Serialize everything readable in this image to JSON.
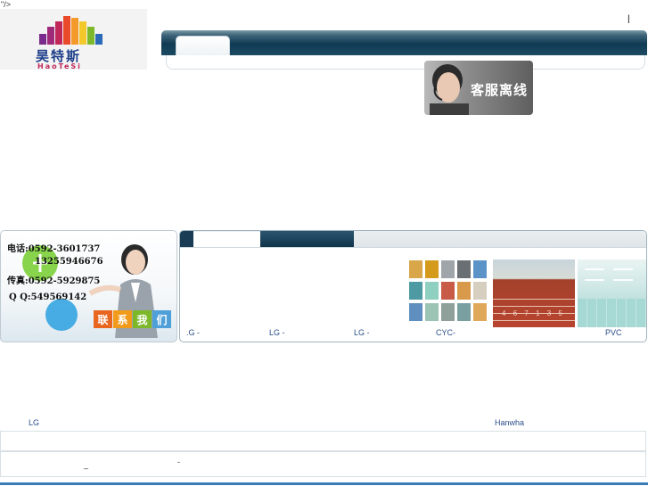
{
  "page": {
    "stray_text": "\"/>",
    "caret_text": "|"
  },
  "logo": {
    "chinese": "昊特斯",
    "latin": "HaoTeSi",
    "colors": [
      "#7a2a8a",
      "#c0285a",
      "#e84a2a",
      "#f39a2a",
      "#f3c82a",
      "#2a6ab8"
    ]
  },
  "header": {
    "customer_service_label": "客服离线"
  },
  "contact": {
    "phone": "电话:0592-3601737",
    "mobile": "13255946676",
    "fax": "传真:0592-5929875",
    "qq": "Q Q:549569142",
    "button_chars": [
      "联",
      "系",
      "我",
      "们"
    ],
    "button_colors": [
      "#e8661e",
      "#f29a1a",
      "#7cb82a",
      "#4fa0d8"
    ]
  },
  "products": {
    "labels": [
      ".G -",
      "LG -",
      "LG -",
      "CYC-",
      "PVC"
    ],
    "swatch_colors": [
      "#d9a64a",
      "#d49a1c",
      "#9fa5a8",
      "#6a6f74",
      "#5b93c9",
      "#4d9aa2",
      "#8fd0c0",
      "#c85a48",
      "#d89a4a",
      "#d6cfc0",
      "#5f8fbf",
      "#9cc4b4",
      "#8fa09a",
      "#7a9fa0",
      "#e0a85a"
    ],
    "track_marks": "4 6 7 1 3 5"
  },
  "brands": {
    "left": "LG",
    "right": "Hanwha"
  },
  "footer": {
    "underscore": "_",
    "dash": "-"
  }
}
